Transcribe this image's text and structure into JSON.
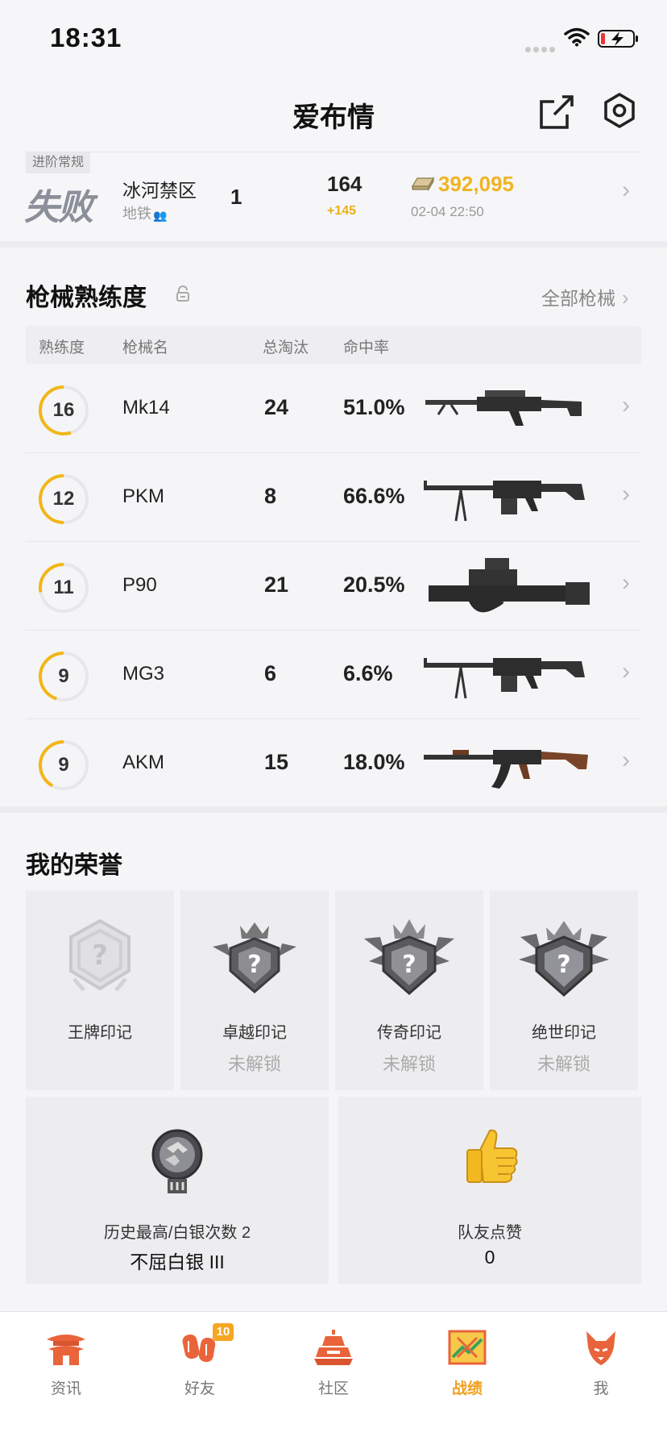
{
  "status_bar": {
    "time": "18:31"
  },
  "header": {
    "title": "爱布情"
  },
  "last_match": {
    "tag": "进阶常规",
    "result": "失败",
    "map": "冰河禁区",
    "mode": "地铁",
    "rank": "1",
    "score": "164",
    "score_delta": "+145",
    "coins": "392,095",
    "datetime": "02-04 22:50"
  },
  "weapons": {
    "title": "枪械熟练度",
    "all_link": "全部枪械",
    "columns": [
      "熟练度",
      "枪械名",
      "总淘汰",
      "命中率"
    ],
    "rows": [
      {
        "level": "16",
        "name": "Mk14",
        "kills": "24",
        "accuracy": "51.0%",
        "progress": 0.55,
        "gun_icon": "marksman-rifle-icon"
      },
      {
        "level": "12",
        "name": "PKM",
        "kills": "8",
        "accuracy": "66.6%",
        "progress": 0.5,
        "gun_icon": "machine-gun-icon"
      },
      {
        "level": "11",
        "name": "P90",
        "kills": "21",
        "accuracy": "20.5%",
        "progress": 0.28,
        "gun_icon": "smg-icon"
      },
      {
        "level": "9",
        "name": "MG3",
        "kills": "6",
        "accuracy": "6.6%",
        "progress": 0.45,
        "gun_icon": "machine-gun-icon"
      },
      {
        "level": "9",
        "name": "AKM",
        "kills": "15",
        "accuracy": "18.0%",
        "progress": 0.42,
        "gun_icon": "assault-rifle-icon"
      }
    ]
  },
  "honors": {
    "title": "我的荣誉",
    "badges": [
      {
        "name": "王牌印记",
        "status": ""
      },
      {
        "name": "卓越印记",
        "status": "未解锁"
      },
      {
        "name": "传奇印记",
        "status": "未解锁"
      },
      {
        "name": "绝世印记",
        "status": "未解锁"
      }
    ],
    "rank_card": {
      "label": "历史最高/白银次数 2",
      "value": "不屈白银 III"
    },
    "likes_card": {
      "label": "队友点赞",
      "value": "0"
    }
  },
  "tabs": [
    {
      "label": "资讯",
      "icon": "news-pagoda-icon"
    },
    {
      "label": "好友",
      "icon": "friends-lantern-icon",
      "badge": "10"
    },
    {
      "label": "社区",
      "icon": "community-bell-icon"
    },
    {
      "label": "战绩",
      "icon": "record-scroll-icon",
      "active": true
    },
    {
      "label": "我",
      "icon": "profile-fox-icon"
    }
  ],
  "colors": {
    "accent": "#f0b421",
    "progress": "#f2b618",
    "text": "#222222",
    "muted": "#999999",
    "tab_icon": "#e9643a"
  }
}
